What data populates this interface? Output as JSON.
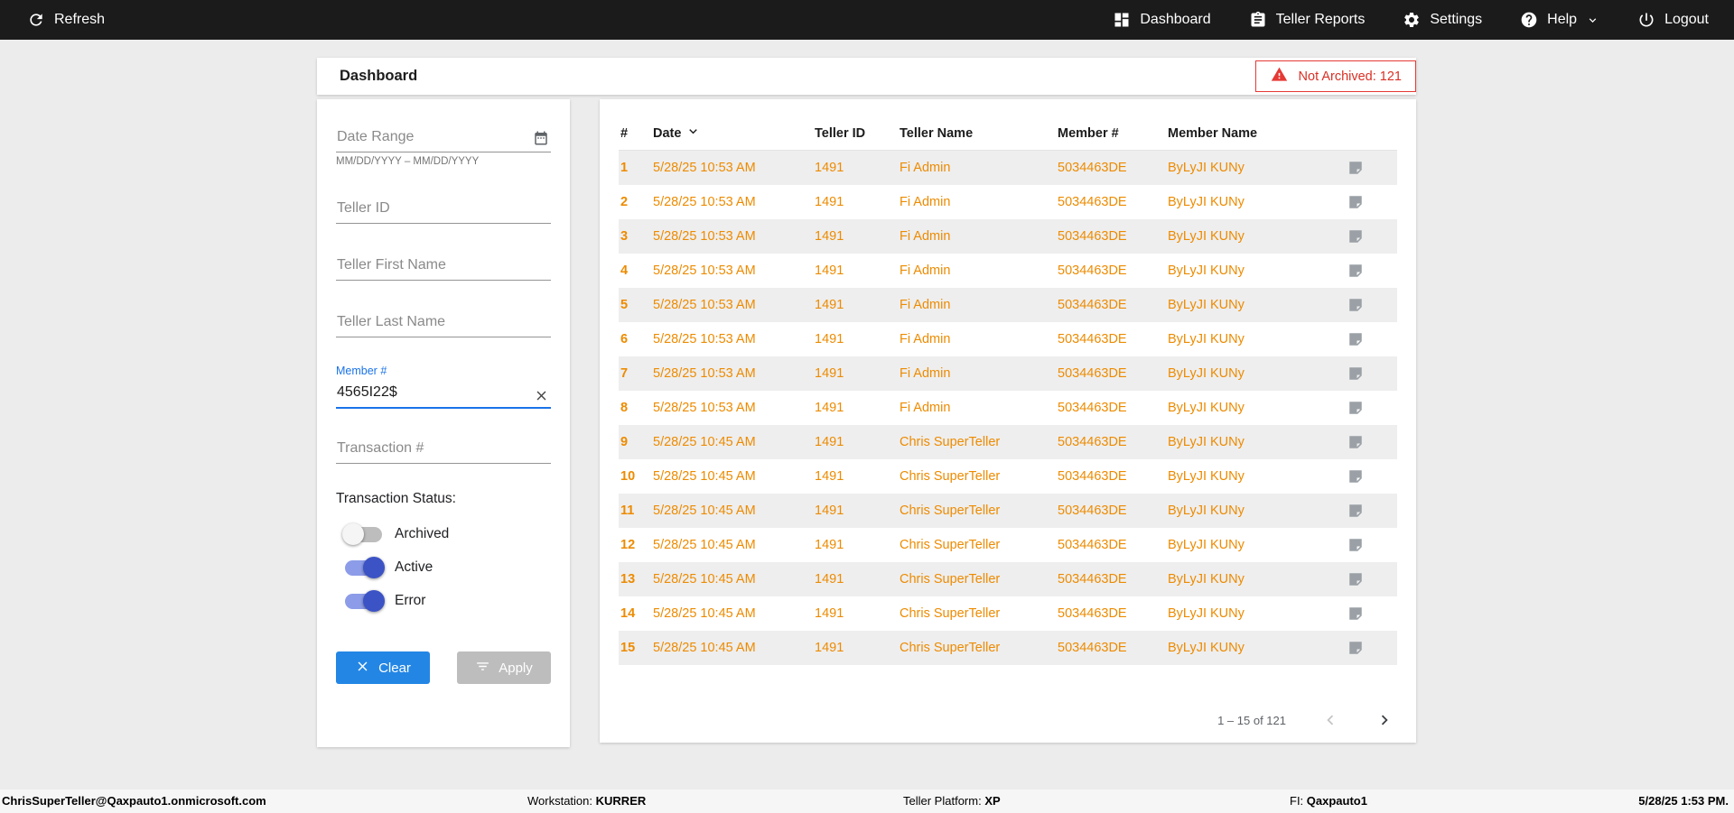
{
  "topbar": {
    "refresh_label": "Refresh",
    "items": [
      {
        "label": "Dashboard"
      },
      {
        "label": "Teller Reports"
      },
      {
        "label": "Settings"
      },
      {
        "label": "Help"
      },
      {
        "label": "Logout"
      }
    ]
  },
  "header": {
    "title": "Dashboard",
    "not_archived": "Not Archived: 121"
  },
  "filters": {
    "date_range": {
      "placeholder": "Date Range",
      "hint": "MM/DD/YYYY – MM/DD/YYYY"
    },
    "teller_id": {
      "placeholder": "Teller ID"
    },
    "teller_first_name": {
      "placeholder": "Teller First Name"
    },
    "teller_last_name": {
      "placeholder": "Teller Last Name"
    },
    "member": {
      "label": "Member #",
      "value": "4565I22$"
    },
    "transaction": {
      "placeholder": "Transaction #"
    },
    "status_label": "Transaction Status:",
    "toggles": [
      {
        "label": "Archived",
        "on": false
      },
      {
        "label": "Active",
        "on": true
      },
      {
        "label": "Error",
        "on": true
      }
    ],
    "clear_label": "Clear",
    "apply_label": "Apply"
  },
  "table": {
    "columns": {
      "num": "#",
      "date": "Date",
      "teller_id": "Teller ID",
      "teller_name": "Teller Name",
      "member": "Member #",
      "member_name": "Member Name"
    },
    "row_keys": [
      "num",
      "date",
      "teller_id",
      "teller_name",
      "member",
      "member_name"
    ],
    "rows": [
      {
        "num": "1",
        "date": "5/28/25 10:53 AM",
        "teller_id": "1491",
        "teller_name": "Fi Admin",
        "member": "5034463DE",
        "member_name": "ByLyJI KUNy"
      },
      {
        "num": "2",
        "date": "5/28/25 10:53 AM",
        "teller_id": "1491",
        "teller_name": "Fi Admin",
        "member": "5034463DE",
        "member_name": "ByLyJI KUNy"
      },
      {
        "num": "3",
        "date": "5/28/25 10:53 AM",
        "teller_id": "1491",
        "teller_name": "Fi Admin",
        "member": "5034463DE",
        "member_name": "ByLyJI KUNy"
      },
      {
        "num": "4",
        "date": "5/28/25 10:53 AM",
        "teller_id": "1491",
        "teller_name": "Fi Admin",
        "member": "5034463DE",
        "member_name": "ByLyJI KUNy"
      },
      {
        "num": "5",
        "date": "5/28/25 10:53 AM",
        "teller_id": "1491",
        "teller_name": "Fi Admin",
        "member": "5034463DE",
        "member_name": "ByLyJI KUNy"
      },
      {
        "num": "6",
        "date": "5/28/25 10:53 AM",
        "teller_id": "1491",
        "teller_name": "Fi Admin",
        "member": "5034463DE",
        "member_name": "ByLyJI KUNy"
      },
      {
        "num": "7",
        "date": "5/28/25 10:53 AM",
        "teller_id": "1491",
        "teller_name": "Fi Admin",
        "member": "5034463DE",
        "member_name": "ByLyJI KUNy"
      },
      {
        "num": "8",
        "date": "5/28/25 10:53 AM",
        "teller_id": "1491",
        "teller_name": "Fi Admin",
        "member": "5034463DE",
        "member_name": "ByLyJI KUNy"
      },
      {
        "num": "9",
        "date": "5/28/25 10:45 AM",
        "teller_id": "1491",
        "teller_name": "Chris SuperTeller",
        "member": "5034463DE",
        "member_name": "ByLyJI KUNy"
      },
      {
        "num": "10",
        "date": "5/28/25 10:45 AM",
        "teller_id": "1491",
        "teller_name": "Chris SuperTeller",
        "member": "5034463DE",
        "member_name": "ByLyJI KUNy"
      },
      {
        "num": "11",
        "date": "5/28/25 10:45 AM",
        "teller_id": "1491",
        "teller_name": "Chris SuperTeller",
        "member": "5034463DE",
        "member_name": "ByLyJI KUNy"
      },
      {
        "num": "12",
        "date": "5/28/25 10:45 AM",
        "teller_id": "1491",
        "teller_name": "Chris SuperTeller",
        "member": "5034463DE",
        "member_name": "ByLyJI KUNy"
      },
      {
        "num": "13",
        "date": "5/28/25 10:45 AM",
        "teller_id": "1491",
        "teller_name": "Chris SuperTeller",
        "member": "5034463DE",
        "member_name": "ByLyJI KUNy"
      },
      {
        "num": "14",
        "date": "5/28/25 10:45 AM",
        "teller_id": "1491",
        "teller_name": "Chris SuperTeller",
        "member": "5034463DE",
        "member_name": "ByLyJI KUNy"
      },
      {
        "num": "15",
        "date": "5/28/25 10:45 AM",
        "teller_id": "1491",
        "teller_name": "Chris SuperTeller",
        "member": "5034463DE",
        "member_name": "ByLyJI KUNy"
      }
    ],
    "pagination": {
      "range_label": "1 – 15 of 121"
    }
  },
  "footer": {
    "user": "ChrisSuperTeller@Qaxpauto1.onmicrosoft.com",
    "workstation_label": "Workstation:",
    "workstation_value": "KURRER",
    "platform_label": "Teller Platform:",
    "platform_value": "XP",
    "fi_label": "FI:",
    "fi_value": "Qaxpauto1",
    "datetime": "5/28/25 1:53 PM."
  },
  "colors": {
    "accent_orange": "#ED8B00",
    "accent_blue": "#2386E5",
    "toggle_on": "#3C53C6",
    "alert_red": "#E53935",
    "member_label_blue": "#1A73E8"
  }
}
